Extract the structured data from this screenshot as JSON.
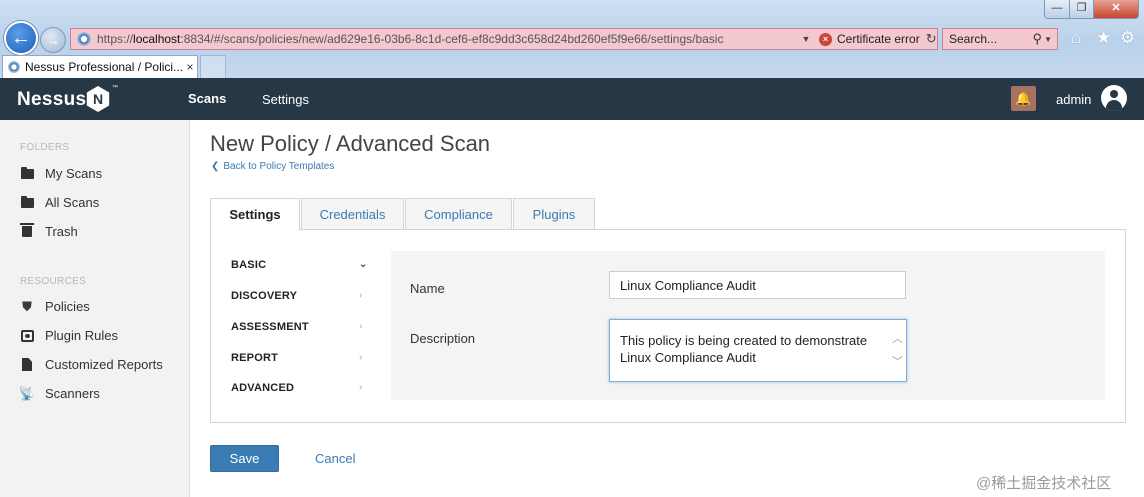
{
  "browser": {
    "url_scheme": "https://",
    "url_host": "localhost",
    "url_rest": ":8834/#/scans/policies/new/ad629e16-03b6-8c1d-cef6-ef8c9dd3c658d24bd260ef5f9e66/settings/basic",
    "cert_error": "Certificate error",
    "search_placeholder": "Search...",
    "tab_title": "Nessus Professional / Polici...",
    "tab_close": "×",
    "back_glyph": "←",
    "fwd_glyph": "→",
    "window_min": "—",
    "window_max": "❐",
    "window_close": "✕"
  },
  "topbar": {
    "logo": "Nessus",
    "logo_mark": "N",
    "logo_tm": "™",
    "nav": [
      {
        "label": "Scans"
      },
      {
        "label": "Settings"
      }
    ],
    "user": "admin"
  },
  "sidebar": {
    "folders_heading": "FOLDERS",
    "folders": [
      {
        "label": "My Scans"
      },
      {
        "label": "All Scans"
      },
      {
        "label": "Trash"
      }
    ],
    "resources_heading": "RESOURCES",
    "resources": [
      {
        "label": "Policies"
      },
      {
        "label": "Plugin Rules"
      },
      {
        "label": "Customized Reports"
      },
      {
        "label": "Scanners"
      }
    ]
  },
  "main": {
    "title": "New Policy / Advanced Scan",
    "back_link": "Back to Policy Templates",
    "tabs": [
      {
        "label": "Settings"
      },
      {
        "label": "Credentials"
      },
      {
        "label": "Compliance"
      },
      {
        "label": "Plugins"
      }
    ],
    "sections": [
      {
        "label": "BASIC"
      },
      {
        "label": "DISCOVERY"
      },
      {
        "label": "ASSESSMENT"
      },
      {
        "label": "REPORT"
      },
      {
        "label": "ADVANCED"
      }
    ],
    "form": {
      "name_label": "Name",
      "name_value": "Linux Compliance Audit",
      "description_label": "Description",
      "description_value": "This policy is being created to demonstrate\nLinux Compliance Audit"
    },
    "save_label": "Save",
    "cancel_label": "Cancel"
  },
  "watermark": "@稀土掘金技术社区",
  "colors": {
    "topbar": "#263746",
    "link": "#3a7ab3",
    "primary_button": "#3a7bb3",
    "bell": "#a77360",
    "address_error": "#f3c8cf"
  }
}
